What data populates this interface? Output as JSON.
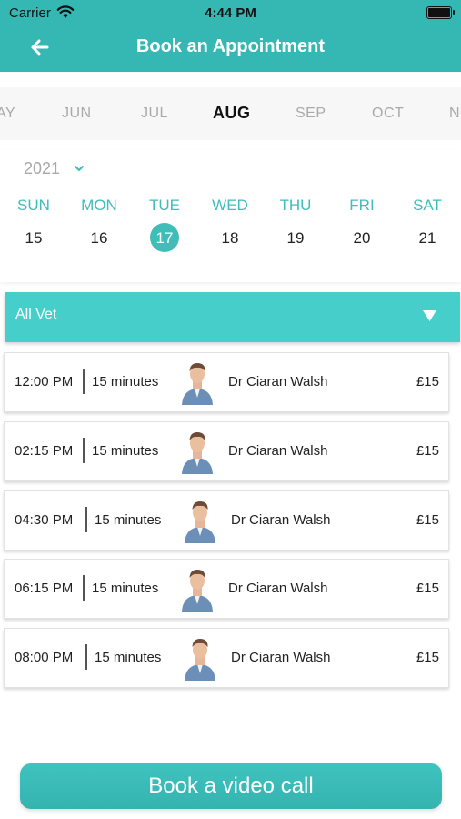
{
  "status_bar": {
    "carrier": "Carrier",
    "time": "4:44 PM"
  },
  "header": {
    "title": "Book an Appointment"
  },
  "months": [
    {
      "label": "AY"
    },
    {
      "label": "JUN"
    },
    {
      "label": "JUL"
    },
    {
      "label": "AUG",
      "active": true
    },
    {
      "label": "SEP"
    },
    {
      "label": "OCT"
    },
    {
      "label": "NO"
    }
  ],
  "calendar": {
    "year": "2021",
    "days": [
      {
        "name": "SUN",
        "num": "15"
      },
      {
        "name": "MON",
        "num": "16"
      },
      {
        "name": "TUE",
        "num": "17",
        "selected": true
      },
      {
        "name": "WED",
        "num": "18"
      },
      {
        "name": "THU",
        "num": "19"
      },
      {
        "name": "FRI",
        "num": "20"
      },
      {
        "name": "SAT",
        "num": "21"
      }
    ]
  },
  "vet_filter": {
    "label": "All Vet"
  },
  "appointments": [
    {
      "time": "12:00 PM",
      "duration": "15 minutes",
      "vet": "Dr Ciaran Walsh",
      "price": "£15"
    },
    {
      "time": "02:15 PM",
      "duration": "15 minutes",
      "vet": "Dr Ciaran Walsh",
      "price": "£15"
    },
    {
      "time": "04:30 PM",
      "duration": "15 minutes",
      "vet": "Dr Ciaran Walsh",
      "price": "£15"
    },
    {
      "time": "06:15 PM",
      "duration": "15 minutes",
      "vet": "Dr Ciaran Walsh",
      "price": "£15"
    },
    {
      "time": "08:00 PM",
      "duration": "15 minutes",
      "vet": "Dr Ciaran Walsh",
      "price": "£15"
    }
  ],
  "book_button": {
    "label": "Book a video call"
  },
  "colors": {
    "accent": "#35b8b3",
    "vet_bar": "#46cecb",
    "day_name": "#3ebdb9"
  }
}
